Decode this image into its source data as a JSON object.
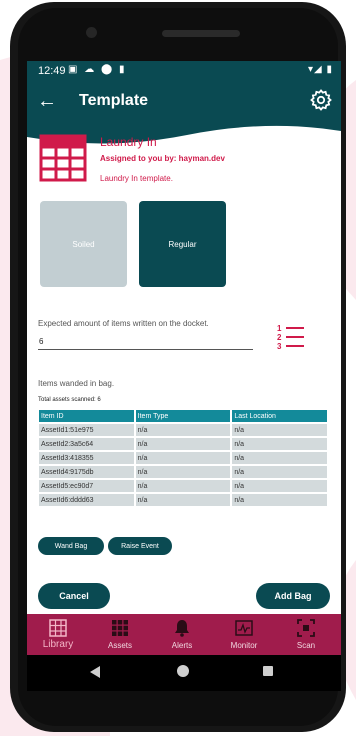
{
  "status_bar": {
    "time": "12:49",
    "left_icons": "▣ ☁ ⬤ ▮",
    "right_icons": "▾◢ ▮"
  },
  "app_bar": {
    "back_icon": "arrow-left-icon",
    "title": "Template",
    "settings_icon": "gear-icon"
  },
  "template": {
    "icon": "table-icon",
    "name": "Laundry In",
    "assigned": "Assigned to you by: hayman.dev",
    "description": "Laundry In template."
  },
  "tiles": [
    {
      "label": "Soiled",
      "selected": false
    },
    {
      "label": "Regular",
      "selected": true
    }
  ],
  "expected": {
    "label": "Expected amount of items written on the docket.",
    "value": "6",
    "list_icon": "numbered-list-icon"
  },
  "wanded": {
    "label": "Items wanded in bag.",
    "total": "Total assets scanned: 6",
    "columns": [
      "Item ID",
      "Item Type",
      "Last Location"
    ],
    "rows": [
      [
        "AssetId1:51e975",
        "n/a",
        "n/a"
      ],
      [
        "AssetId2:3a5c64",
        "n/a",
        "n/a"
      ],
      [
        "AssetId3:418355",
        "n/a",
        "n/a"
      ],
      [
        "AssetId4:9175db",
        "n/a",
        "n/a"
      ],
      [
        "AssetId5:ec90d7",
        "n/a",
        "n/a"
      ],
      [
        "AssetId6:dddd63",
        "n/a",
        "n/a"
      ]
    ]
  },
  "actions": {
    "wand_bag": "Wand Bag",
    "raise_event": "Raise Event",
    "cancel": "Cancel",
    "add_bag": "Add Bag"
  },
  "nav": [
    {
      "label": "Library",
      "icon": "library-grid-icon",
      "active": true
    },
    {
      "label": "Assets",
      "icon": "assets-grid-icon",
      "active": false
    },
    {
      "label": "Alerts",
      "icon": "bell-icon",
      "active": false
    },
    {
      "label": "Monitor",
      "icon": "monitor-chart-icon",
      "active": false
    },
    {
      "label": "Scan",
      "icon": "scan-icon",
      "active": false
    }
  ],
  "colors": {
    "primary": "#0a4a52",
    "accent": "#d01a4a",
    "table_header": "#138a9a",
    "nav_bar": "#a01c4c",
    "tile_unselected": "#c2ced2"
  }
}
